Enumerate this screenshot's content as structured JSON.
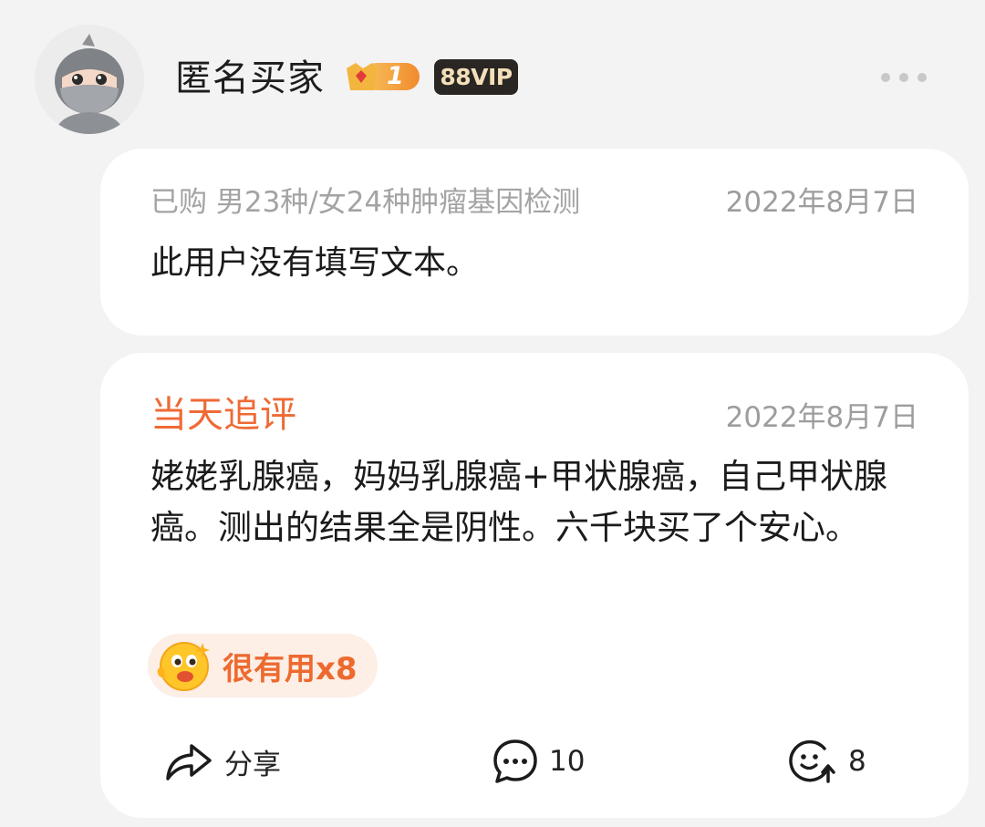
{
  "header": {
    "username": "匿名买家",
    "level": "1",
    "vip_label": "88VIP"
  },
  "review": {
    "purchase_info": "已购 男23种/女24种肿瘤基因检测",
    "date": "2022年8月7日",
    "text": "此用户没有填写文本。"
  },
  "followup": {
    "label": "当天追评",
    "date": "2022年8月7日",
    "text": "姥姥乳腺癌，妈妈乳腺癌+甲状腺癌，自己甲状腺癌。测出的结果全是阴性。六千块买了个安心。"
  },
  "useful": {
    "label": "很有用x8"
  },
  "actions": {
    "share_label": "分享",
    "comment_count": "10",
    "like_count": "8"
  },
  "colors": {
    "accent": "#ef6a35",
    "useful_bg": "#fdeee6",
    "vip_bg": "#2a2623",
    "vip_text": "#f3dfb9",
    "page_bg": "#f3f3f3",
    "card_bg": "#ffffff"
  },
  "icons": {
    "avatar": "ninja-avatar",
    "level_badge": "crown-level-icon",
    "more": "more-dots-icon",
    "useful": "smiley-emoji-icon",
    "share": "share-arrow-icon",
    "comment": "comment-bubble-icon",
    "like": "smiley-up-icon"
  }
}
